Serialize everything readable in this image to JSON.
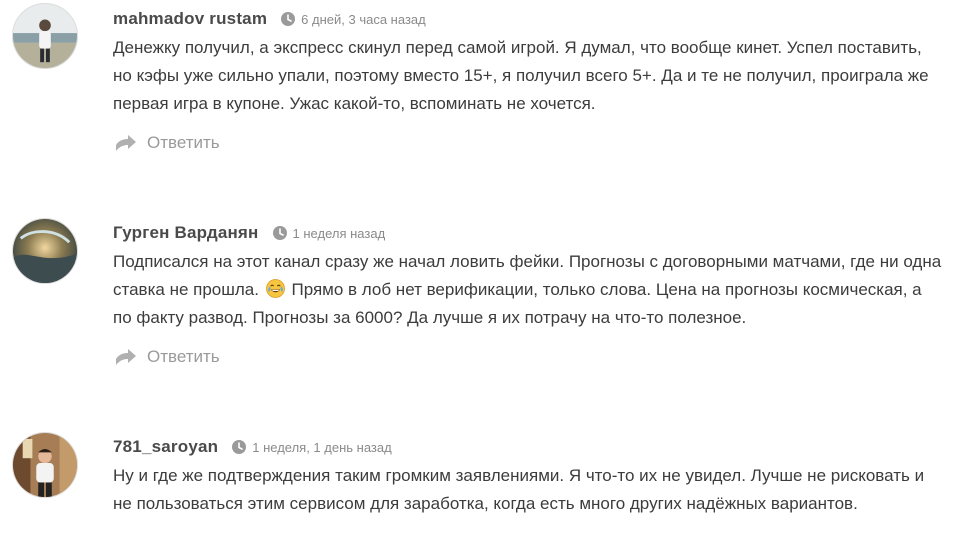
{
  "comments": [
    {
      "author": "mahmadov rustam",
      "time": "6 дней, 3 часа назад",
      "text": "Денежку получил, а экспресс скинул перед самой игрой. Я думал, что вообще кинет. Успел поставить, но кэфы уже сильно упали, поэтому вместо 15+, я получил всего 5+. Да и те не получил, проиграла же первая игра в купоне. Ужас какой-то, вспоминать не хочется.",
      "reply_label": "Ответить"
    },
    {
      "author": "Гурген Варданян",
      "time": "1 неделя назад",
      "text_before": "Подписался на этот канал сразу же начал ловить фейки. Прогнозы с договорными матчами, где ни одна ставка не прошла.",
      "emoji": "face-with-tears-of-joy-icon",
      "text_after": "Прямо в лоб нет верификации, только слова. Цена на прогнозы космическая, а по факту развод. Прогнозы за 6000? Да лучше я их потрачу на что-то полезное.",
      "reply_label": "Ответить"
    },
    {
      "author": "781_saroyan",
      "time": "1 неделя, 1 день назад",
      "text": "Ну и где же подтверждения таким громким заявлениями. Я что-то их не увидел. Лучше не рисковать и не пользоваться этим сервисом для заработка, когда есть много других надёжных вариантов."
    }
  ],
  "icons": {
    "clock": "clock-icon",
    "reply": "reply-arrow-icon"
  },
  "colors": {
    "author": "#4a4a4a",
    "meta": "#8a8a8a",
    "text": "#3c3c3c",
    "reply": "#9a9a9a"
  }
}
